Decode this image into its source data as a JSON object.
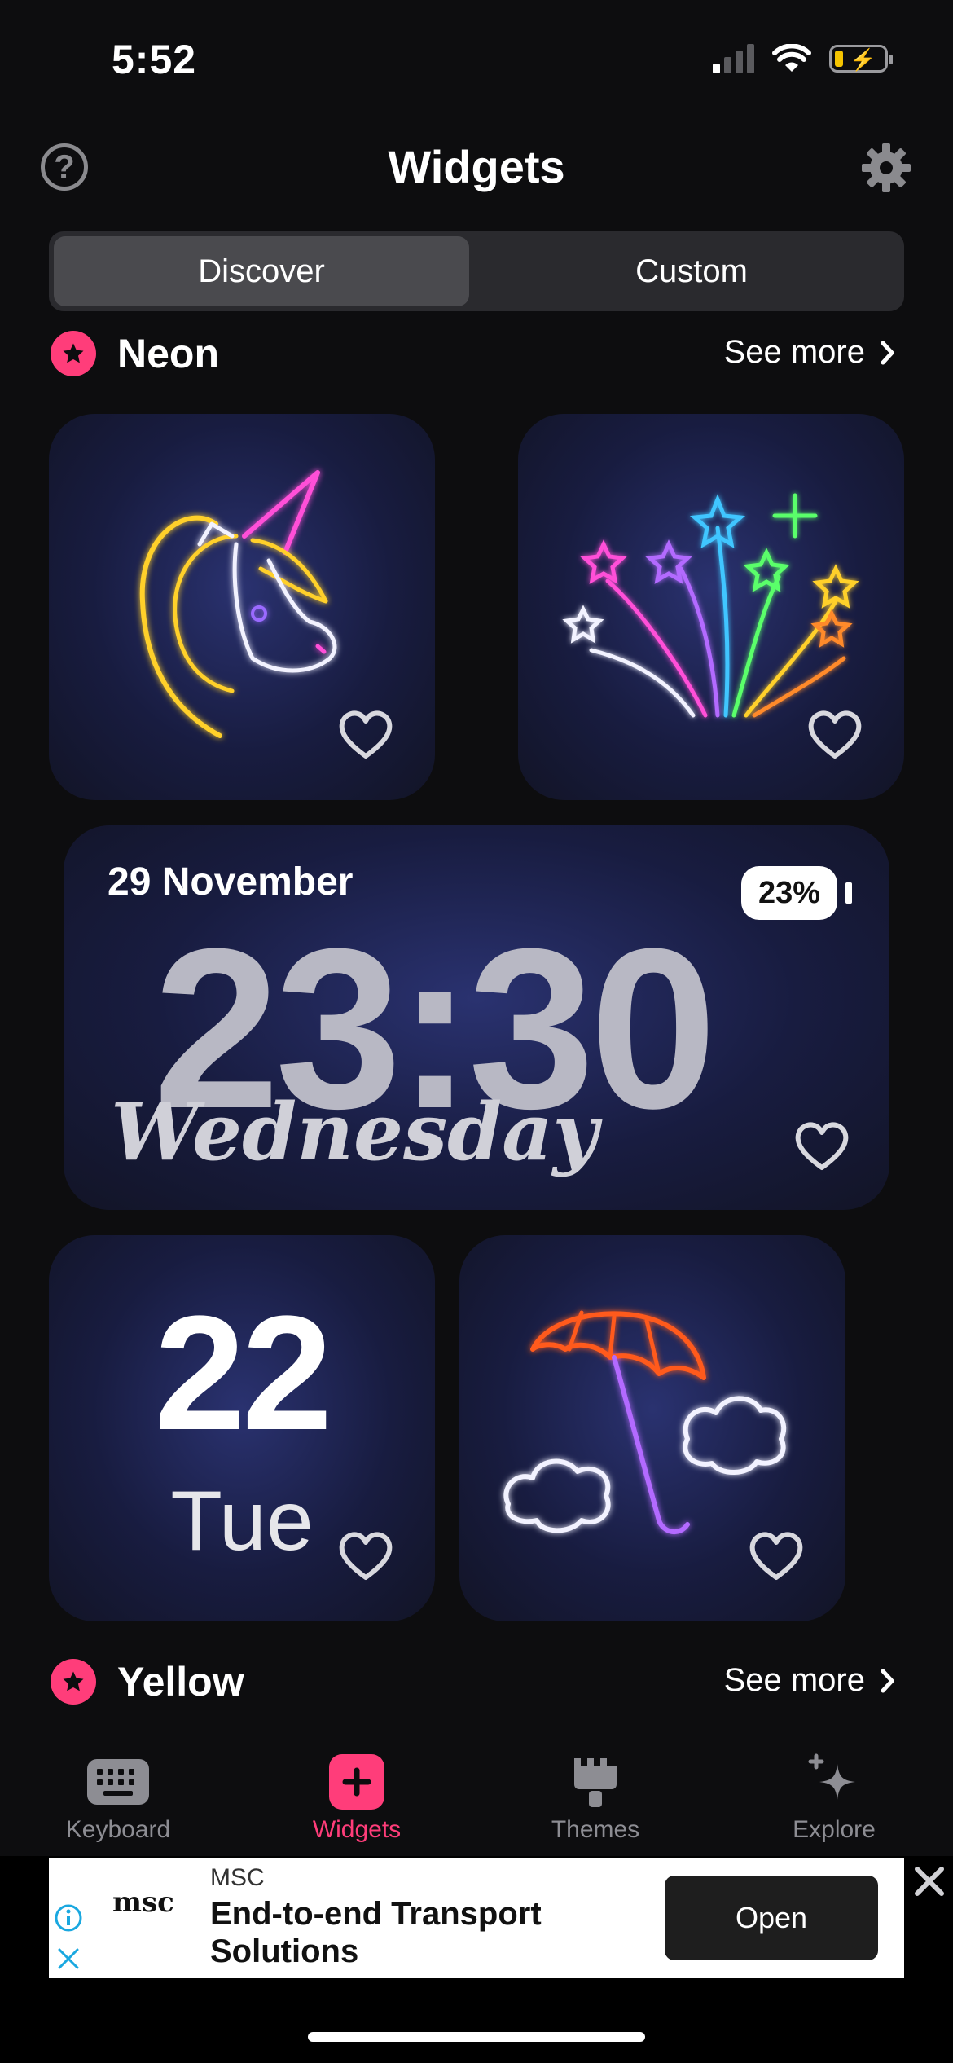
{
  "status_bar": {
    "time": "5:52"
  },
  "header": {
    "title": "Widgets"
  },
  "segmented": {
    "discover": "Discover",
    "custom": "Custom"
  },
  "sections": [
    {
      "title": "Neon",
      "see_more": "See more"
    },
    {
      "title": "Yellow",
      "see_more": "See more"
    }
  ],
  "clock_widget": {
    "date": "29 November",
    "time": "23:30",
    "weekday": "Wednesday",
    "battery": "23%"
  },
  "date_widget": {
    "day": "22",
    "weekday": "Tue"
  },
  "tabs": [
    {
      "label": "Keyboard",
      "icon": "keyboard-icon"
    },
    {
      "label": "Widgets",
      "icon": "plus-icon"
    },
    {
      "label": "Themes",
      "icon": "brush-icon"
    },
    {
      "label": "Explore",
      "icon": "sparkle-icon"
    }
  ],
  "ad": {
    "advertiser": "MSC",
    "logo_text": "msc",
    "headline": "End-to-end Transport Solutions",
    "cta": "Open"
  },
  "colors": {
    "accent": "#ff3d7a",
    "background": "#0d0d0f",
    "card": "#1e2350"
  }
}
